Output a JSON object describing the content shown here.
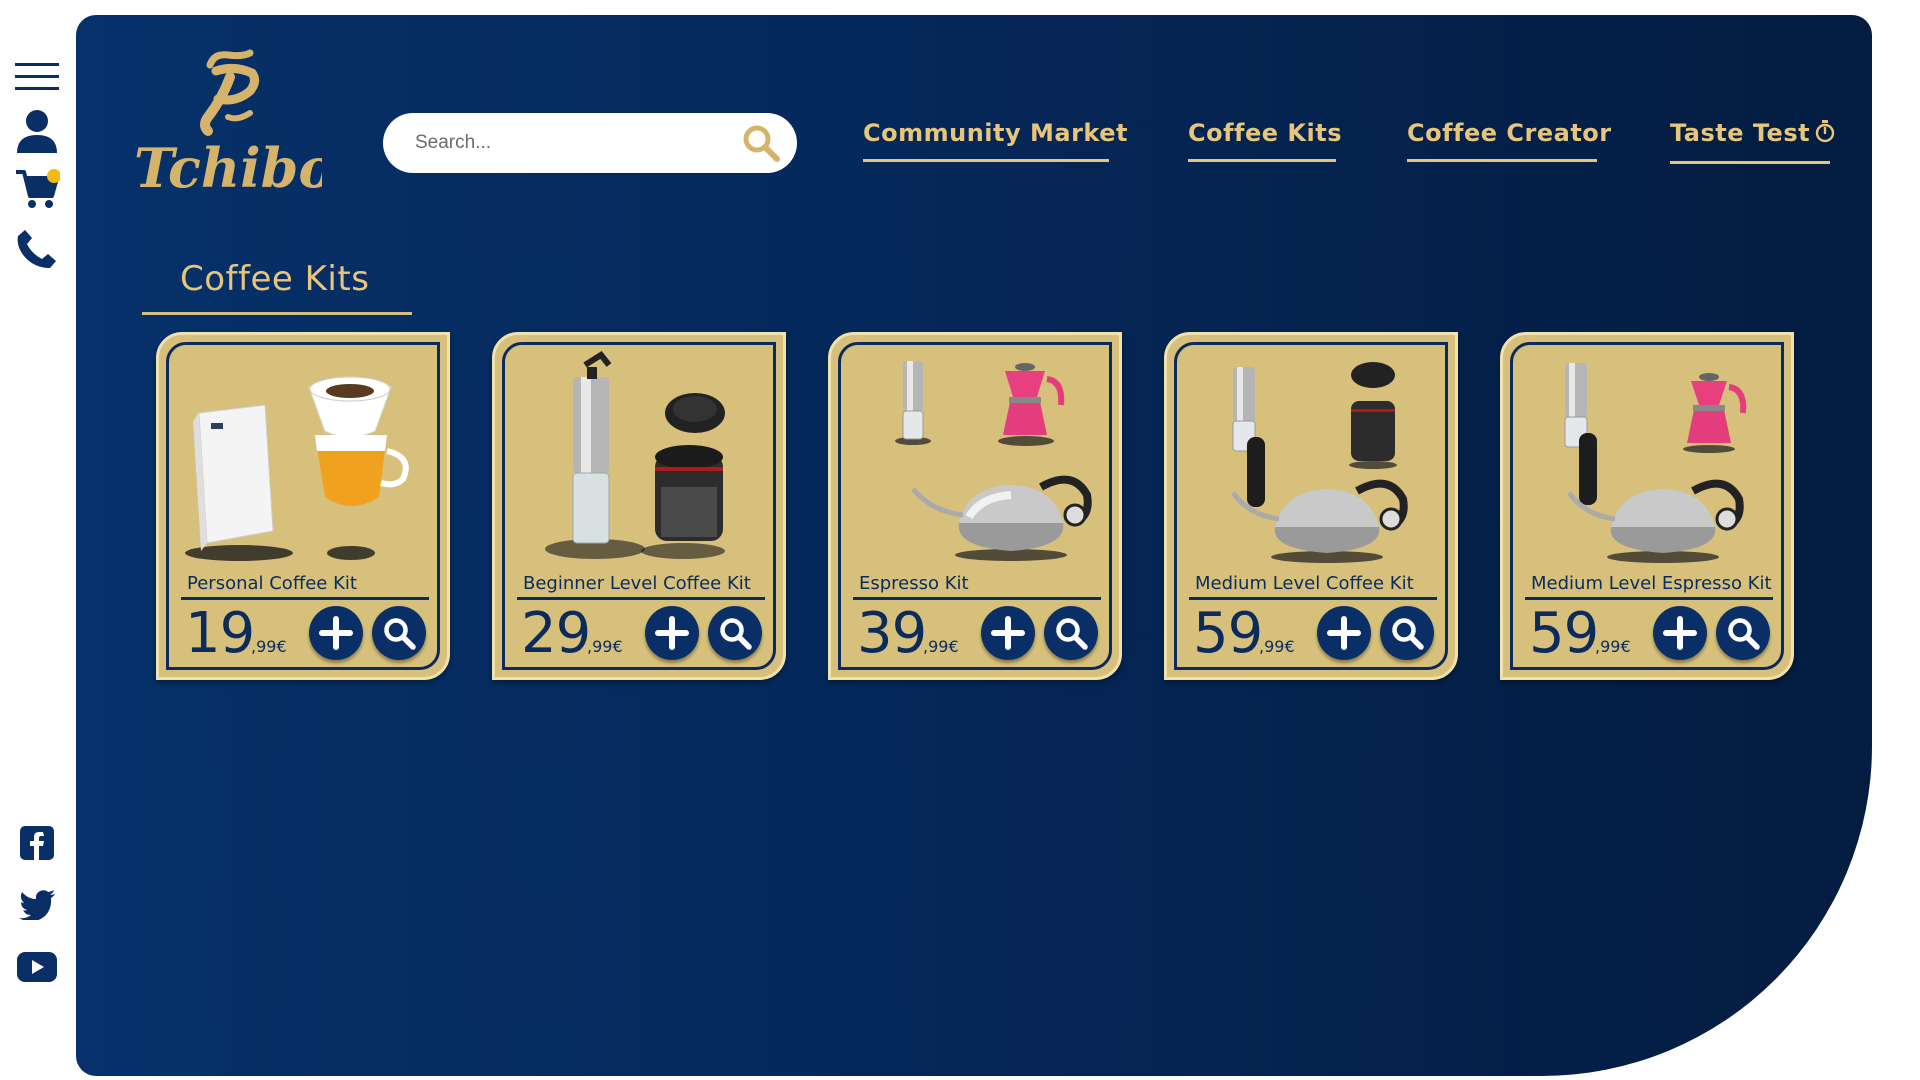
{
  "brand": {
    "name": "Tchibo",
    "gold": "#e7c67b",
    "navy": "#0a2b5c"
  },
  "sidebar": {
    "top_icons": [
      {
        "name": "menu-icon"
      },
      {
        "name": "user-icon"
      },
      {
        "name": "cart-icon",
        "badge_color": "#f5b914"
      },
      {
        "name": "phone-icon"
      }
    ],
    "social_icons": [
      {
        "name": "facebook-icon"
      },
      {
        "name": "twitter-icon"
      },
      {
        "name": "youtube-icon"
      }
    ]
  },
  "search": {
    "placeholder": "Search..."
  },
  "nav": {
    "items": [
      {
        "label": "Community Market"
      },
      {
        "label": "Coffee Kits"
      },
      {
        "label": "Coffee Creator"
      },
      {
        "label": "Taste Test"
      }
    ]
  },
  "section": {
    "title": "Coffee Kits"
  },
  "products": [
    {
      "name": "Personal Coffee Kit",
      "price_main": "19",
      "price_cents": ",99€"
    },
    {
      "name": "Beginner Level Coffee Kit",
      "price_main": "29",
      "price_cents": ",99€"
    },
    {
      "name": "Espresso Kit",
      "price_main": "39",
      "price_cents": ",99€"
    },
    {
      "name": "Medium Level Coffee Kit",
      "price_main": "59",
      "price_cents": ",99€"
    },
    {
      "name": "Medium Level Espresso Kit",
      "price_main": "59",
      "price_cents": ",99€"
    }
  ]
}
